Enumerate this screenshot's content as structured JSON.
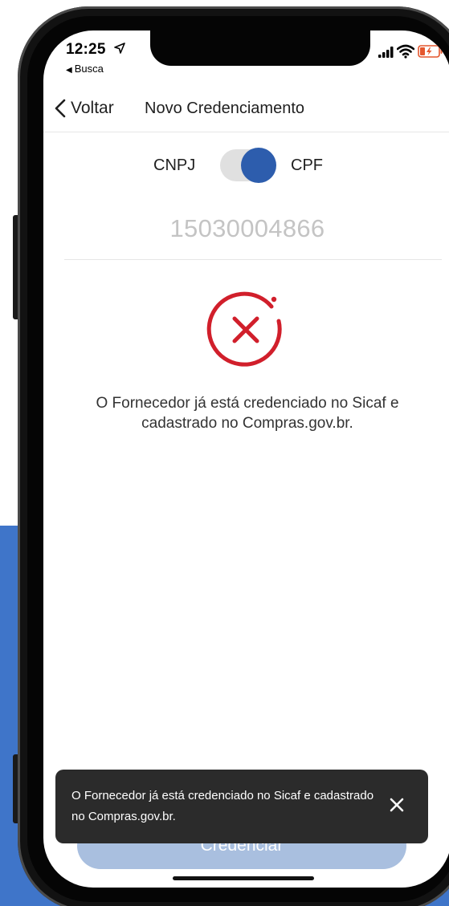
{
  "status_bar": {
    "time": "12:25",
    "back_app": "Busca"
  },
  "nav": {
    "back_label": "Voltar",
    "title": "Novo Credenciamento"
  },
  "toggle": {
    "left_label": "CNPJ",
    "right_label": "CPF",
    "selected": "CPF",
    "active_color": "#2d5dad"
  },
  "document": {
    "number": "15030004866"
  },
  "result": {
    "icon": "error-x-circle-icon",
    "icon_color": "#d11f2b",
    "message": "O Fornecedor já está credenciado no Sicaf e cadastrado no Compras.gov.br."
  },
  "actions": {
    "primary_label": "Credenciar"
  },
  "toast": {
    "message": "O Fornecedor já está credenciado no Sicaf e cadastrado no Compras.gov.br.",
    "close_icon": "close-icon"
  },
  "colors": {
    "background_accent": "#3f75c9",
    "button_disabled": "#a9bfdf",
    "toast_bg": "#2b2b2b"
  }
}
